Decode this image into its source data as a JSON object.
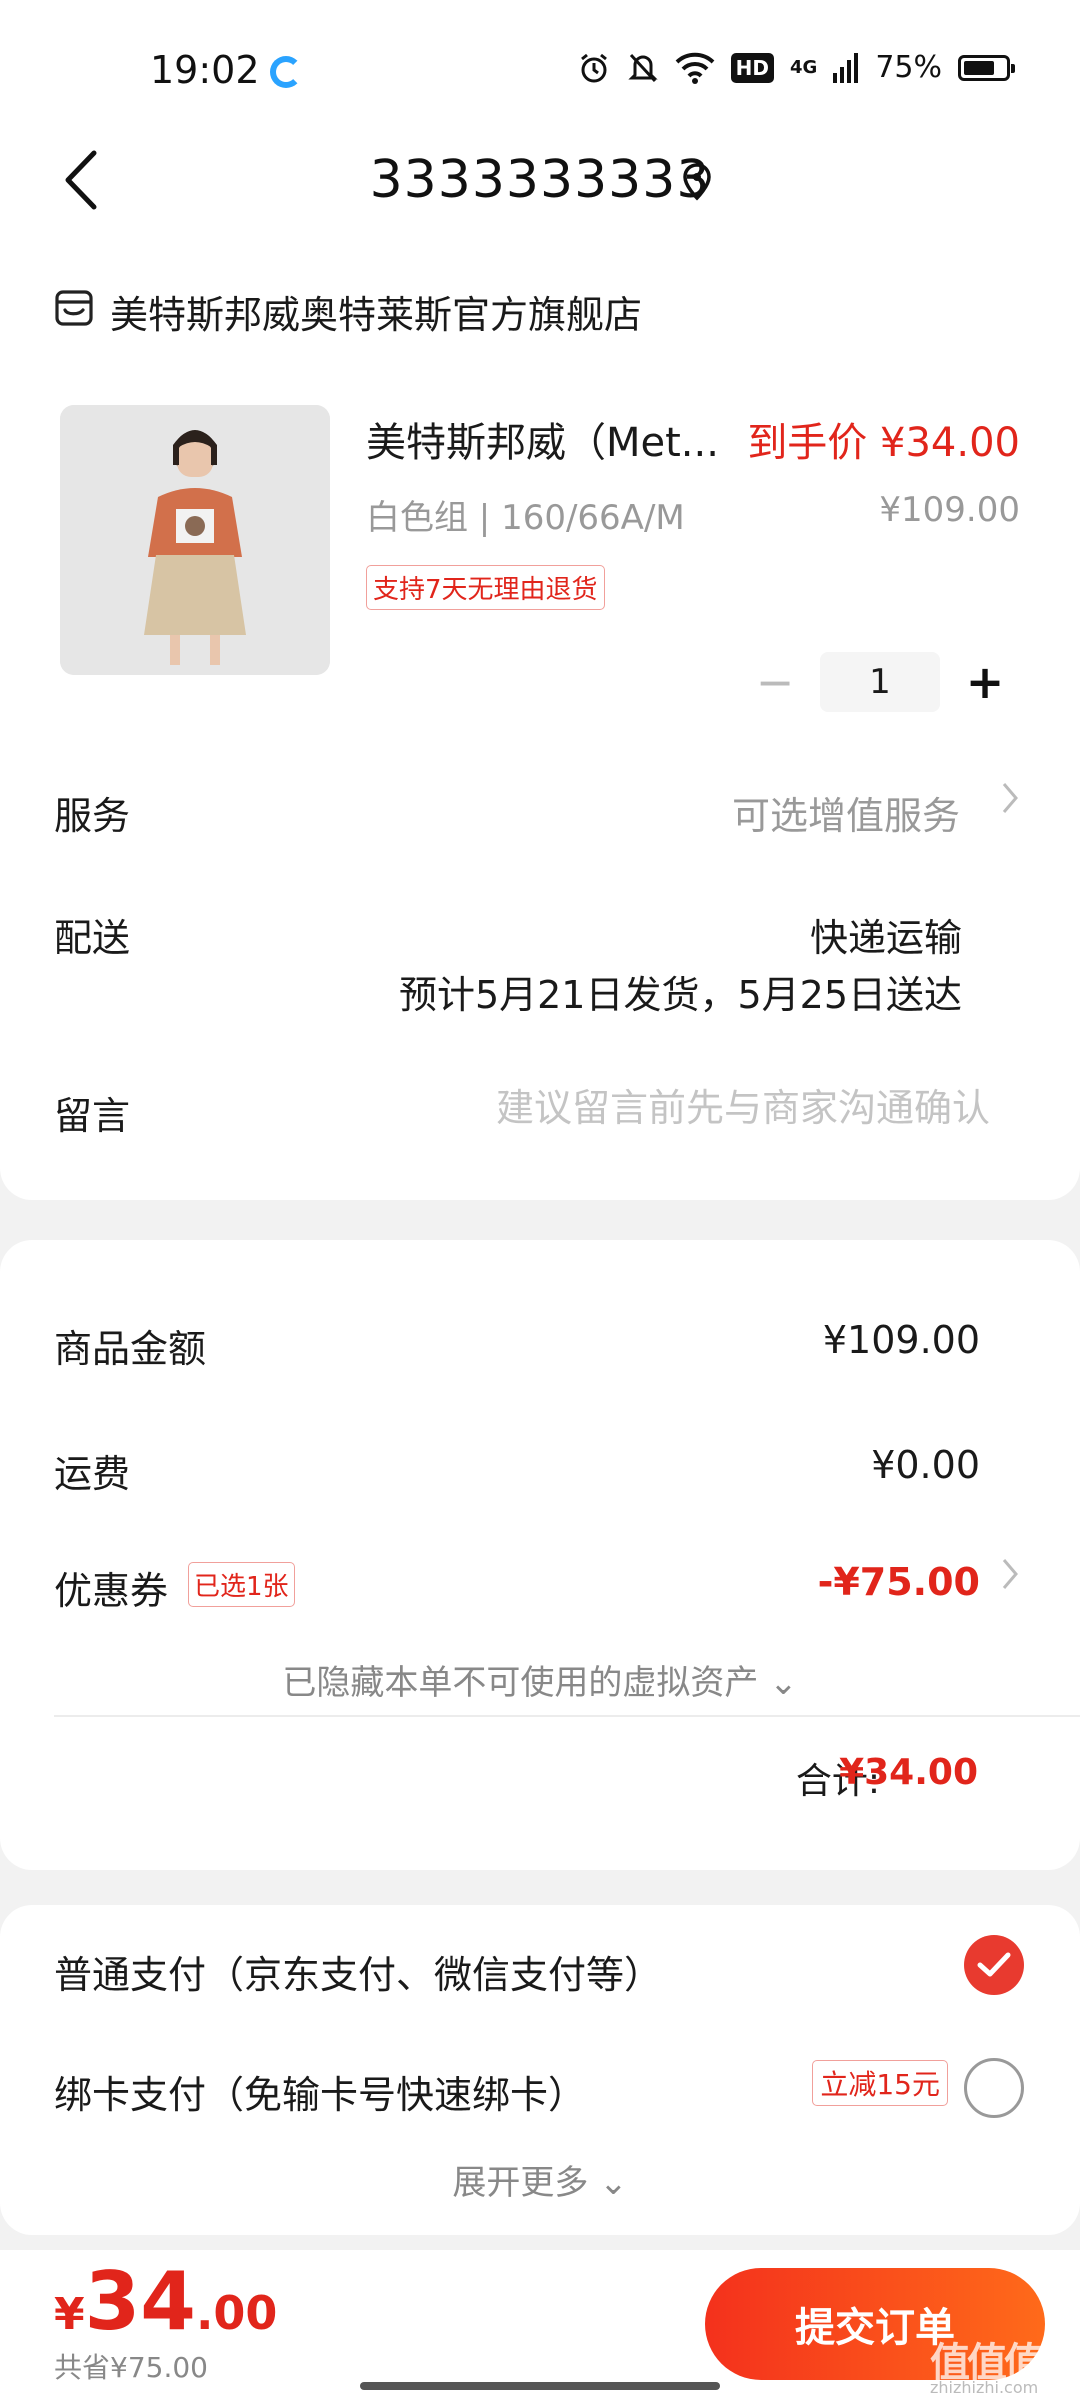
{
  "status_bar": {
    "time": "19:02",
    "network": "4G",
    "battery": "75%",
    "battery_level": 0.75,
    "hd_badge": "HD",
    "icons": [
      "alarm-icon",
      "mute-bell-icon",
      "wifi-icon",
      "hd-icon",
      "signal-icon",
      "battery-icon"
    ]
  },
  "header": {
    "title": "3333333333",
    "back_icon": "back-chevron-icon",
    "location_icon": "location-pin-icon"
  },
  "store": {
    "name": "美特斯邦威奥特莱斯官方旗舰店",
    "icon": "store-icon"
  },
  "product": {
    "name": "美特斯邦威（Met...",
    "deal_price": "到手价 ¥34.00",
    "spec": "白色组 | 160/66A/M",
    "original_price": "¥109.00",
    "return_tag": "支持7天无理由退货",
    "quantity": "1",
    "minus": "−",
    "plus": "+"
  },
  "service": {
    "label": "服务",
    "value": "可选增值服务"
  },
  "delivery": {
    "label": "配送",
    "method": "快递运输",
    "estimate": "预计5月21日发货，5月25日送达"
  },
  "note": {
    "label": "留言",
    "placeholder": "建议留言前先与商家沟通确认"
  },
  "summary": {
    "goods_label": "商品金额",
    "goods_value": "¥109.00",
    "shipping_label": "运费",
    "shipping_value": "¥0.00",
    "coupon_label": "优惠券",
    "coupon_tag": "已选1张",
    "coupon_value": "-¥75.00",
    "hidden_assets": "已隐藏本单不可使用的虚拟资产 ⌄",
    "total_label": "合计:",
    "total_value": "¥34.00"
  },
  "payment": {
    "option1": "普通支付（京东支付、微信支付等）",
    "option2": "绑卡支付（免输卡号快速绑卡）",
    "option2_tag": "立减15元",
    "expand": "展开更多 ⌄",
    "selected": "option1"
  },
  "bottom": {
    "currency": "¥",
    "total_int": "34",
    "total_dec": ".00",
    "saved": "共省¥75.00",
    "submit": "提交订单"
  },
  "watermark": {
    "text": "值值值",
    "sub": "zhizhizhi.com"
  },
  "colors": {
    "accent_red": "#e1251b",
    "submit_gradient_start": "#f4311c",
    "submit_gradient_end": "#ff6a1a",
    "page_bg": "#f2f2f2"
  }
}
